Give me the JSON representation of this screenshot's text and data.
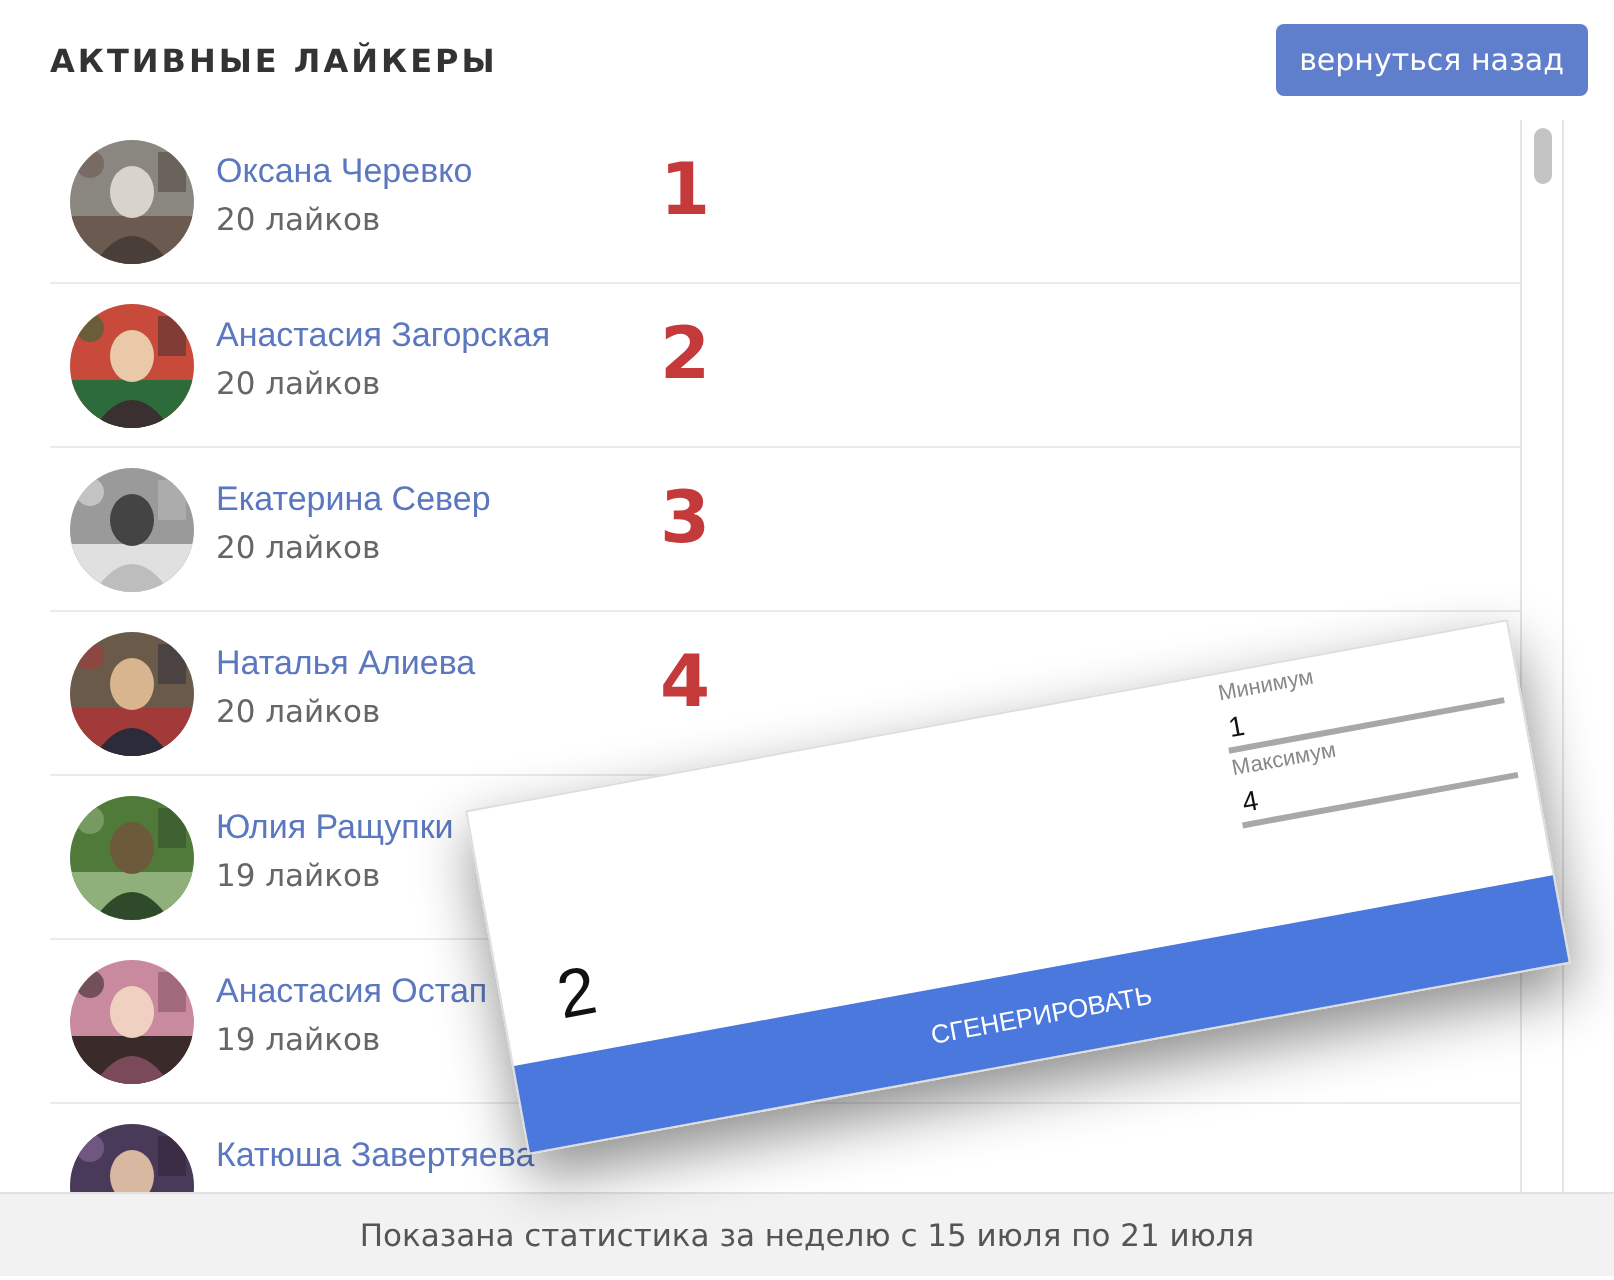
{
  "header": {
    "title": "АКТИВНЫЕ ЛАЙКЕРЫ",
    "back_button": "вернуться назад"
  },
  "likers": [
    {
      "name": "Оксана Черевко",
      "likes": "20 лайков",
      "rank": "1"
    },
    {
      "name": "Анастасия Загорская",
      "likes": "20 лайков",
      "rank": "2"
    },
    {
      "name": "Екатерина Север",
      "likes": "20 лайков",
      "rank": "3"
    },
    {
      "name": "Наталья Алиева",
      "likes": "20 лайков",
      "rank": "4"
    },
    {
      "name": "Юлия Ращупки",
      "likes": "19 лайков"
    },
    {
      "name": "Анастасия Остап",
      "likes": "19 лайков"
    },
    {
      "name": "Катюша Завертяева"
    }
  ],
  "footer": "Показана статистика за неделю с 15 июля по 21 июля",
  "generator": {
    "result": "2",
    "min_label": "Минимум",
    "min_value": "1",
    "max_label": "Максимум",
    "max_value": "4",
    "button": "СГЕНЕРИРОВАТЬ"
  }
}
